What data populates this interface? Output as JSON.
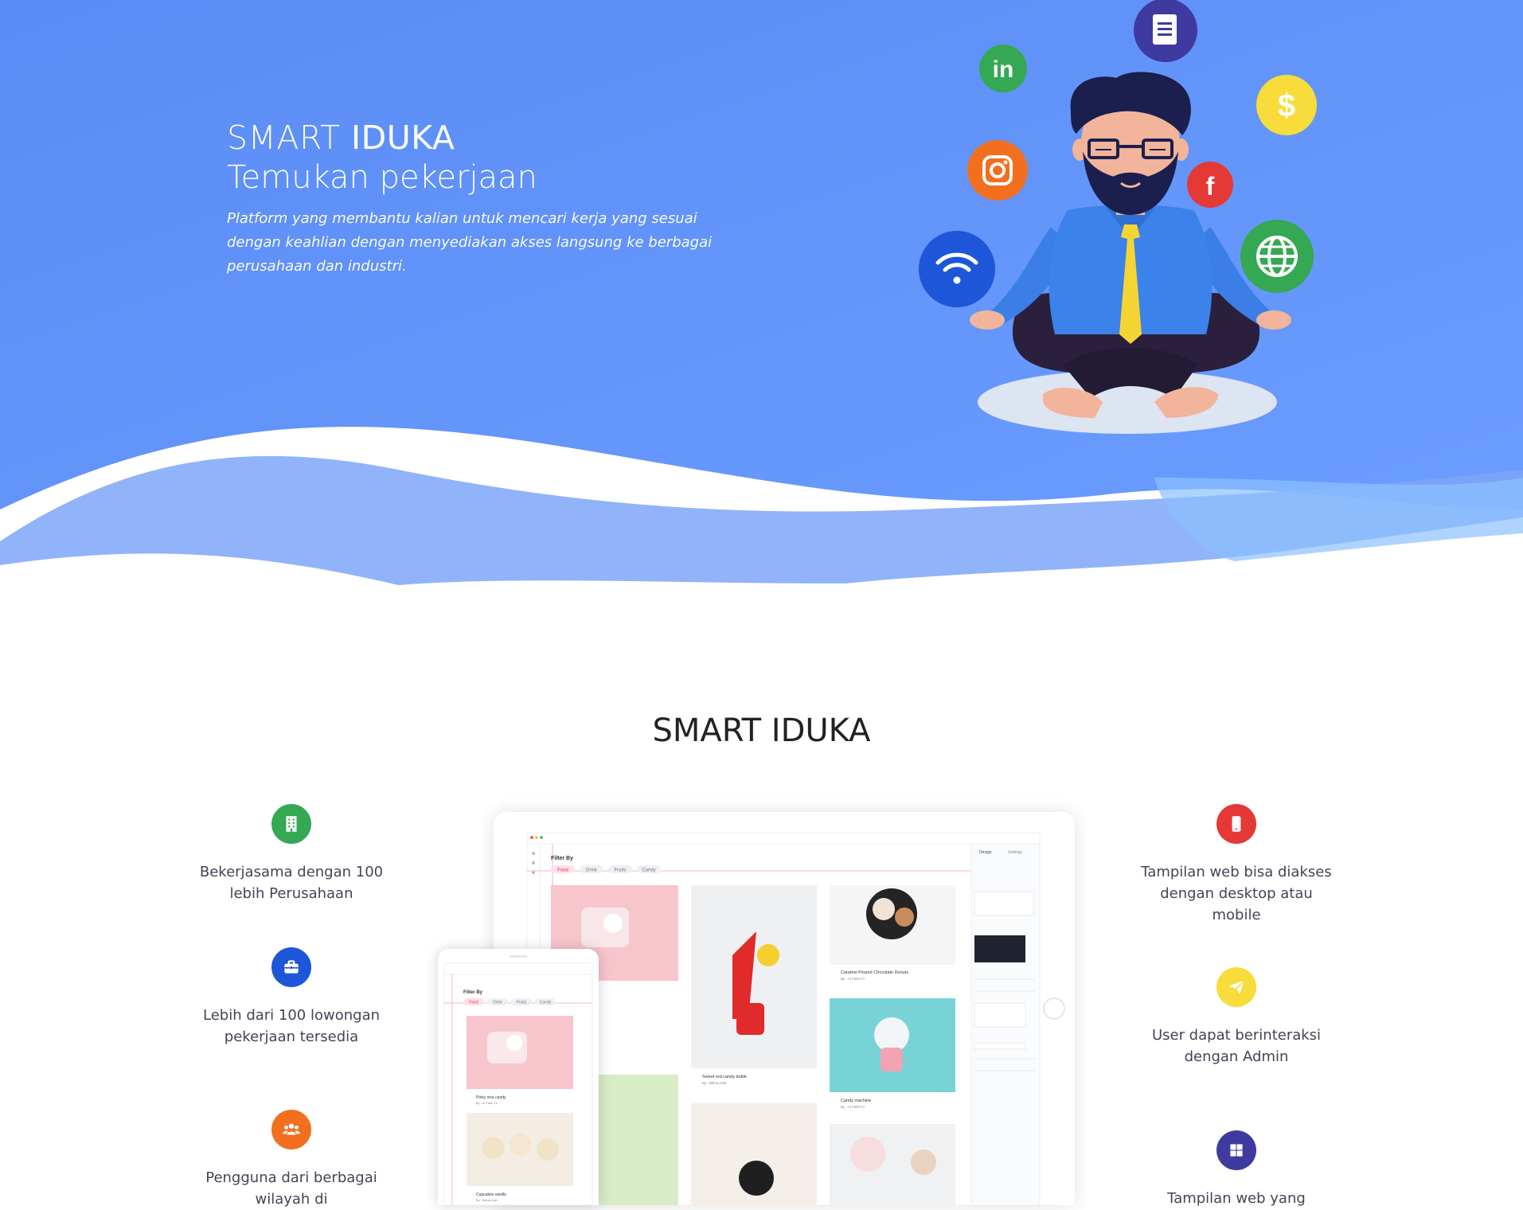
{
  "hero": {
    "title_light": "SMART ",
    "title_bold": "IDUKA",
    "subtitle": "Temukan pekerjaan",
    "description": "Platform yang membantu kalian untuk mencari kerja yang sesuai dengan keahlian dengan menyediakan akses langsung ke berbagai perusahaan dan industri.",
    "floating_icons": [
      {
        "icon": "document-icon",
        "color": "#3f3aa0"
      },
      {
        "icon": "linkedin-icon",
        "color": "#34a853"
      },
      {
        "icon": "dollar-icon",
        "color": "#f7dc3c"
      },
      {
        "icon": "instagram-icon",
        "color": "#f26f1f"
      },
      {
        "icon": "facebook-icon",
        "color": "#e53935"
      },
      {
        "icon": "wifi-icon",
        "color": "#1e56d9"
      },
      {
        "icon": "globe-icon",
        "color": "#34a853"
      }
    ],
    "colors": {
      "gradient_start": "#5a8ef5",
      "gradient_end": "#7fb3ff"
    }
  },
  "section": {
    "title": "SMART IDUKA"
  },
  "features_left": [
    {
      "icon": "building-icon",
      "color": "#34a853",
      "text": "Bekerjasama dengan 100 lebih Perusahaan"
    },
    {
      "icon": "briefcase-icon",
      "color": "#1e56d9",
      "text": "Lebih dari 100 lowongan pekerjaan tersedia"
    },
    {
      "icon": "users-icon",
      "color": "#f26f1f",
      "text": "Pengguna dari berbagai wilayah di"
    }
  ],
  "features_right": [
    {
      "icon": "mobile-icon",
      "color": "#e53935",
      "text": "Tampilan web bisa diakses dengan desktop atau mobile"
    },
    {
      "icon": "send-icon",
      "color": "#f7dc3c",
      "text": "User dapat berinteraksi dengan Admin"
    },
    {
      "icon": "windows-icon",
      "color": "#3f3aa0",
      "text": "Tampilan web yang"
    }
  ],
  "mockup": {
    "filter_label": "Filter By",
    "filters": [
      "Food",
      "Drink",
      "Fruits",
      "Candy"
    ],
    "panel_tabs": [
      "Design",
      "Settings"
    ],
    "cards": [
      {
        "title": "Caramel Peanut Chocolate Donuts",
        "author": "By : Al Fatih Fz"
      },
      {
        "title": "Sweet red candy bottle",
        "author": "By : Bilma Adel"
      },
      {
        "title": "Candy machine",
        "author": "By : Al Fatih Fz"
      },
      {
        "title": "Pinky nice candy",
        "author": "By : Al Fatih Fz"
      },
      {
        "title": "Cupcakes vanilla",
        "author": "By : Bilma Adel"
      }
    ]
  }
}
